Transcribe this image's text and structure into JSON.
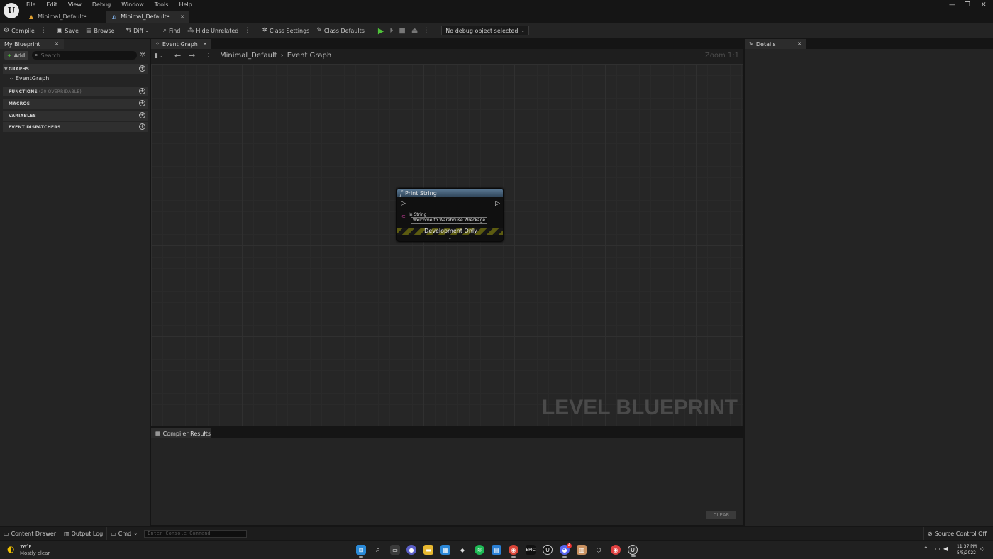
{
  "menu": [
    "File",
    "Edit",
    "View",
    "Debug",
    "Window",
    "Tools",
    "Help"
  ],
  "doc_tabs": [
    {
      "label": "Minimal_Default•",
      "active": false
    },
    {
      "label": "Minimal_Default•",
      "active": true
    }
  ],
  "window_controls": {
    "minimize": "—",
    "restore": "❐",
    "close": "✕"
  },
  "toolbar": {
    "compile": "Compile",
    "save": "Save",
    "browse": "Browse",
    "diff": "Diff",
    "find": "Find",
    "hide_unrelated": "Hide Unrelated",
    "class_settings": "Class Settings",
    "class_defaults": "Class Defaults",
    "debug_object": "No debug object selected"
  },
  "my_blueprint": {
    "tab_label": "My Blueprint",
    "add_label": "Add",
    "search_placeholder": "Search",
    "graphs_label": "GRAPHS",
    "event_graph_item": "EventGraph",
    "functions_label": "FUNCTIONS",
    "functions_sub": "(20 OVERRIDABLE)",
    "macros_label": "MACROS",
    "variables_label": "VARIABLES",
    "event_dispatchers_label": "EVENT DISPATCHERS"
  },
  "graph": {
    "tab_label": "Event Graph",
    "breadcrumb_root": "Minimal_Default",
    "breadcrumb_leaf": "Event Graph",
    "zoom": "Zoom 1:1",
    "watermark": "LEVEL BLUEPRINT"
  },
  "node": {
    "title": "Print String",
    "pin_label": "In String",
    "pin_value": "Welcome to Warehouse Wreckage",
    "banner": "Development Only"
  },
  "compiler": {
    "tab_label": "Compiler Results",
    "clear_label": "CLEAR"
  },
  "details": {
    "tab_label": "Details"
  },
  "statusbar": {
    "content_drawer": "Content Drawer",
    "output_log": "Output Log",
    "cmd": "Cmd",
    "console_placeholder": "Enter Console Command",
    "source_control": "Source Control Off"
  },
  "taskbar": {
    "temperature": "76°F",
    "weather": "Mostly clear",
    "time": "11:37 PM",
    "date": "5/5/2022",
    "discord_badge": "4"
  },
  "colors": {
    "accent_green": "#4fc23a",
    "node_header": "#3d5a74",
    "dev_stripe": "#5c5b10"
  }
}
